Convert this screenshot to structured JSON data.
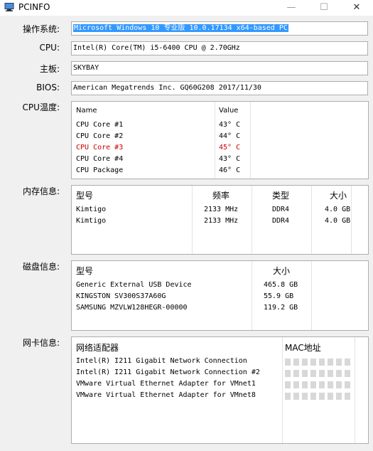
{
  "window": {
    "title": "PCINFO",
    "minimize": "—",
    "maximize": "☐",
    "close": "✕"
  },
  "labels": {
    "os": "操作系统:",
    "cpu": "CPU:",
    "board": "主板:",
    "bios": "BIOS:",
    "cpu_temp": "CPU温度:",
    "memory": "内存信息:",
    "disk": "磁盘信息:",
    "nic": "网卡信息:"
  },
  "fields": {
    "os": "Microsoft Windows 10 专业版 10.0.17134 x64-based PC",
    "cpu": "Intel(R) Core(TM) i5-6400 CPU @ 2.70GHz",
    "board": "SKYBAY",
    "bios": "American Megatrends Inc. GQ60G208 2017/11/30"
  },
  "cpu_temp": {
    "headers": [
      "Name",
      "Value"
    ],
    "rows": [
      {
        "name": "CPU Core #1",
        "value": "43° C",
        "alert": false
      },
      {
        "name": "CPU Core #2",
        "value": "44° C",
        "alert": false
      },
      {
        "name": "CPU Core #3",
        "value": "45° C",
        "alert": true
      },
      {
        "name": "CPU Core #4",
        "value": "43° C",
        "alert": false
      },
      {
        "name": "CPU Package",
        "value": "46° C",
        "alert": false
      }
    ],
    "alert_color": "#cc0000"
  },
  "memory": {
    "headers": [
      "型号",
      "频率",
      "类型",
      "大小"
    ],
    "rows": [
      [
        "Kimtigo",
        "2133 MHz",
        "DDR4",
        "4.0 GB"
      ],
      [
        "Kimtigo",
        "2133 MHz",
        "DDR4",
        "4.0 GB"
      ]
    ]
  },
  "disk": {
    "headers": [
      "型号",
      "大小"
    ],
    "rows": [
      [
        "Generic External USB Device",
        "465.8 GB"
      ],
      [
        "KINGSTON SV300S37A60G",
        "55.9 GB"
      ],
      [
        "SAMSUNG MZVLW128HEGR-00000",
        "119.2 GB"
      ]
    ]
  },
  "nic": {
    "headers": [
      "网络适配器",
      "MAC地址"
    ],
    "rows": [
      "Intel(R) I211 Gigabit Network Connection",
      "Intel(R) I211 Gigabit Network Connection #2",
      "VMware Virtual Ethernet Adapter for VMnet1",
      "VMware Virtual Ethernet Adapter for VMnet8"
    ]
  }
}
